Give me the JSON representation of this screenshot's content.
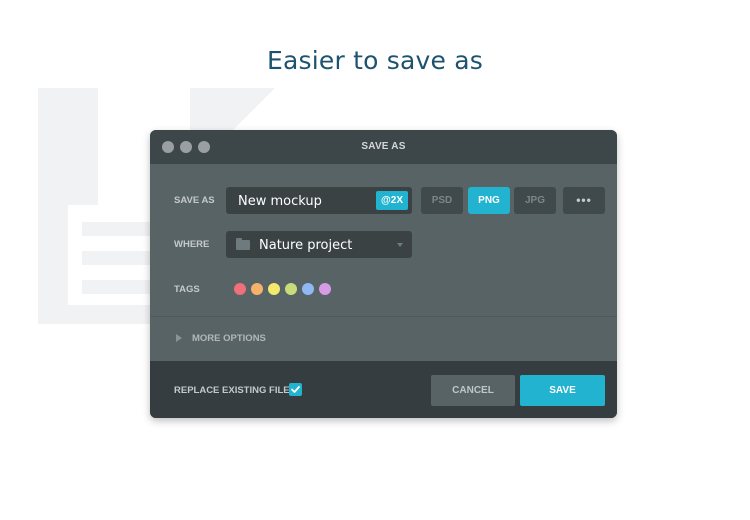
{
  "headline": "Easier to save as",
  "dialog": {
    "title": "SAVE AS",
    "save_as_label": "SAVE AS",
    "file_name": "New mockup",
    "scale_badge": "@2X",
    "formats": [
      {
        "label": "PSD",
        "active": false
      },
      {
        "label": "PNG",
        "active": true
      },
      {
        "label": "JPG",
        "active": false
      }
    ],
    "more_formats_label": "•••",
    "where_label": "WHERE",
    "where_value": "Nature project",
    "tags_label": "TAGS",
    "tags": [
      {
        "name": "red",
        "color": "#ef6f7a"
      },
      {
        "name": "orange",
        "color": "#f6b26b"
      },
      {
        "name": "yellow",
        "color": "#f5e86e"
      },
      {
        "name": "green",
        "color": "#c9dc7c"
      },
      {
        "name": "blue",
        "color": "#8fb8f5"
      },
      {
        "name": "purple",
        "color": "#d79be6"
      }
    ],
    "more_options_label": "MORE OPTIONS",
    "replace_label": "REPLACE EXISTING FILE",
    "replace_checked": true,
    "cancel_label": "CANCEL",
    "save_label": "SAVE"
  },
  "colors": {
    "accent": "#22b3d0",
    "headline": "#1d5370"
  }
}
